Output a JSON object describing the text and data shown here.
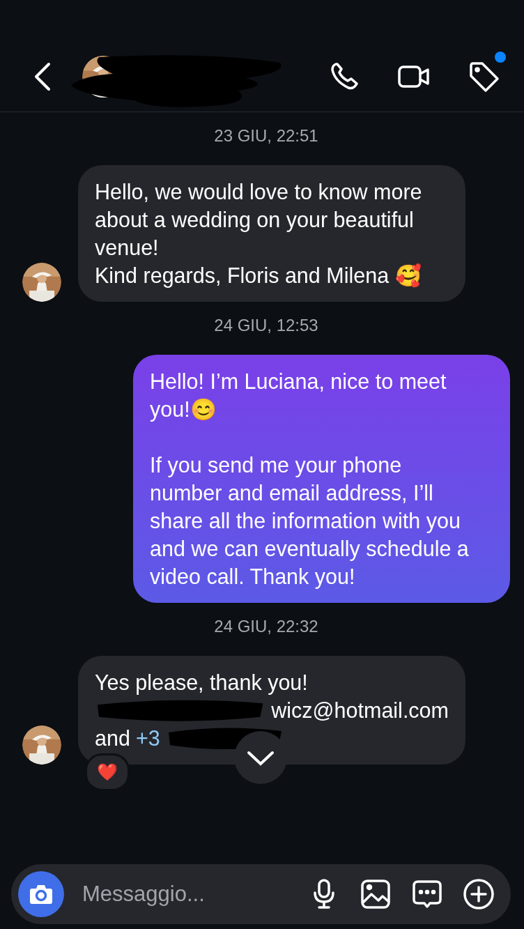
{
  "header": {
    "tag_badge": true
  },
  "messages": [
    {
      "kind": "timestamp",
      "text": "23 GIU, 22:51"
    },
    {
      "kind": "received",
      "text": "Hello, we would love to know more about a wedding on your beautiful venue!\nKind regards, Floris and Milena 🥰"
    },
    {
      "kind": "timestamp",
      "text": "24 GIU, 12:53"
    },
    {
      "kind": "sent",
      "text": "Hello! I’m Luciana, nice to meet you!😊\n\nIf you send me your phone number and email address, I’ll share all the information with you and we can eventually schedule a video call. Thank you!"
    },
    {
      "kind": "timestamp",
      "text": "24 GIU, 22:32"
    },
    {
      "kind": "received",
      "reaction": "❤️",
      "lines": [
        [
          {
            "kind": "text",
            "text": "Yes please, thank you!"
          }
        ],
        [
          {
            "kind": "redacted"
          },
          {
            "kind": "text",
            "text": "wicz@hotmail.com"
          }
        ],
        [
          {
            "kind": "text",
            "text": "and"
          },
          {
            "kind": "link",
            "text": "+3"
          },
          {
            "kind": "redacted"
          }
        ]
      ]
    }
  ],
  "composer": {
    "placeholder": "Messaggio..."
  }
}
